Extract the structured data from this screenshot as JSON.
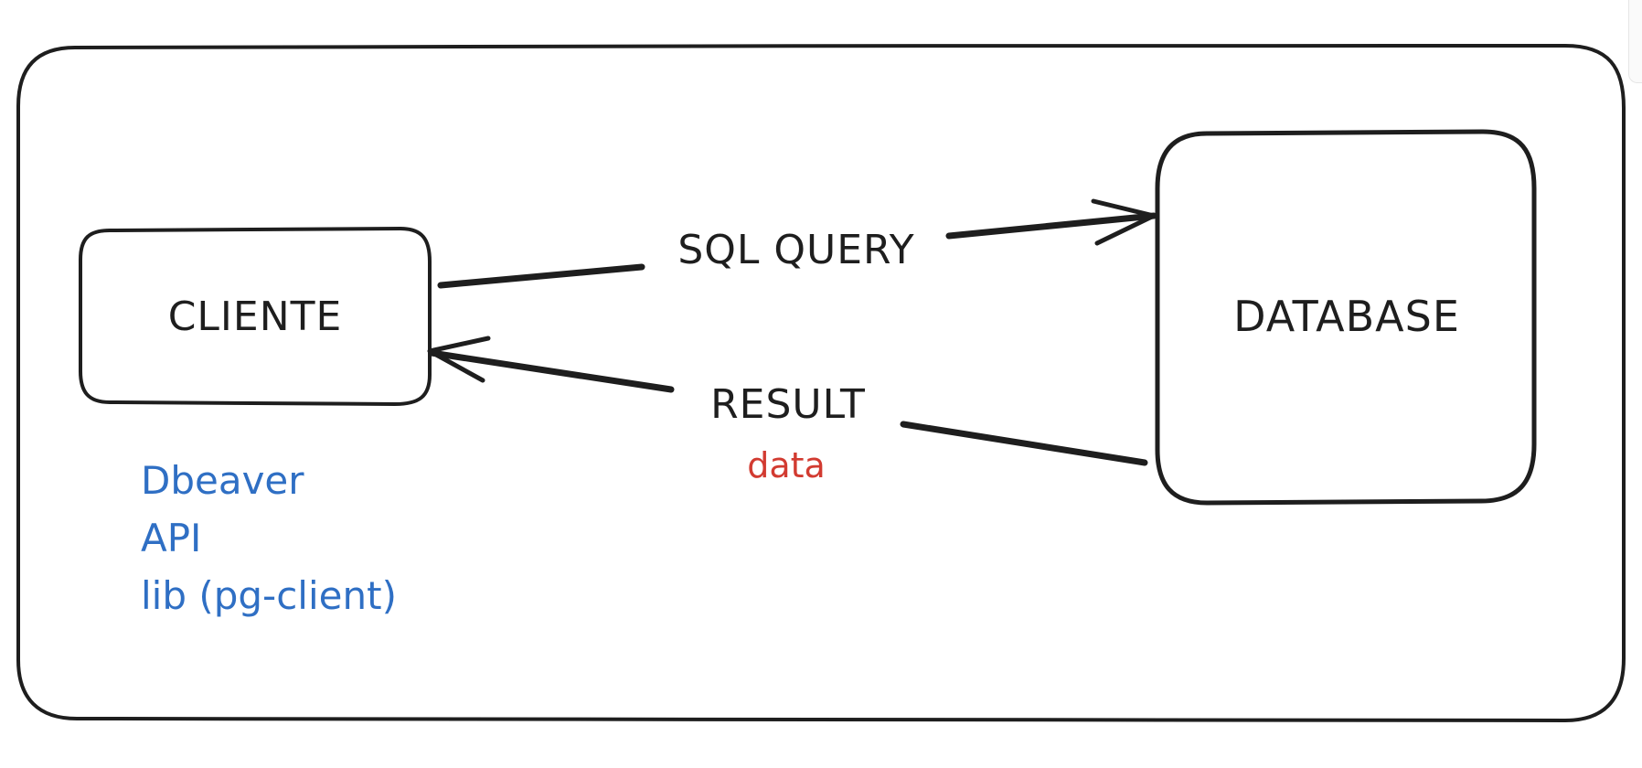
{
  "diagram": {
    "nodes": {
      "client": {
        "label": "CLIENTE"
      },
      "database": {
        "label": "DATABASE"
      }
    },
    "edges": {
      "query": {
        "label": "SQL QUERY"
      },
      "result": {
        "label": "RESULT",
        "sublabel": "data"
      }
    },
    "client_examples": [
      "Dbeaver",
      "API",
      "lib (pg-client)"
    ]
  },
  "colors": {
    "stroke": "#1e1e1e",
    "blue_text": "#2f6fc4",
    "red_text": "#d23b31",
    "background": "#ffffff"
  }
}
